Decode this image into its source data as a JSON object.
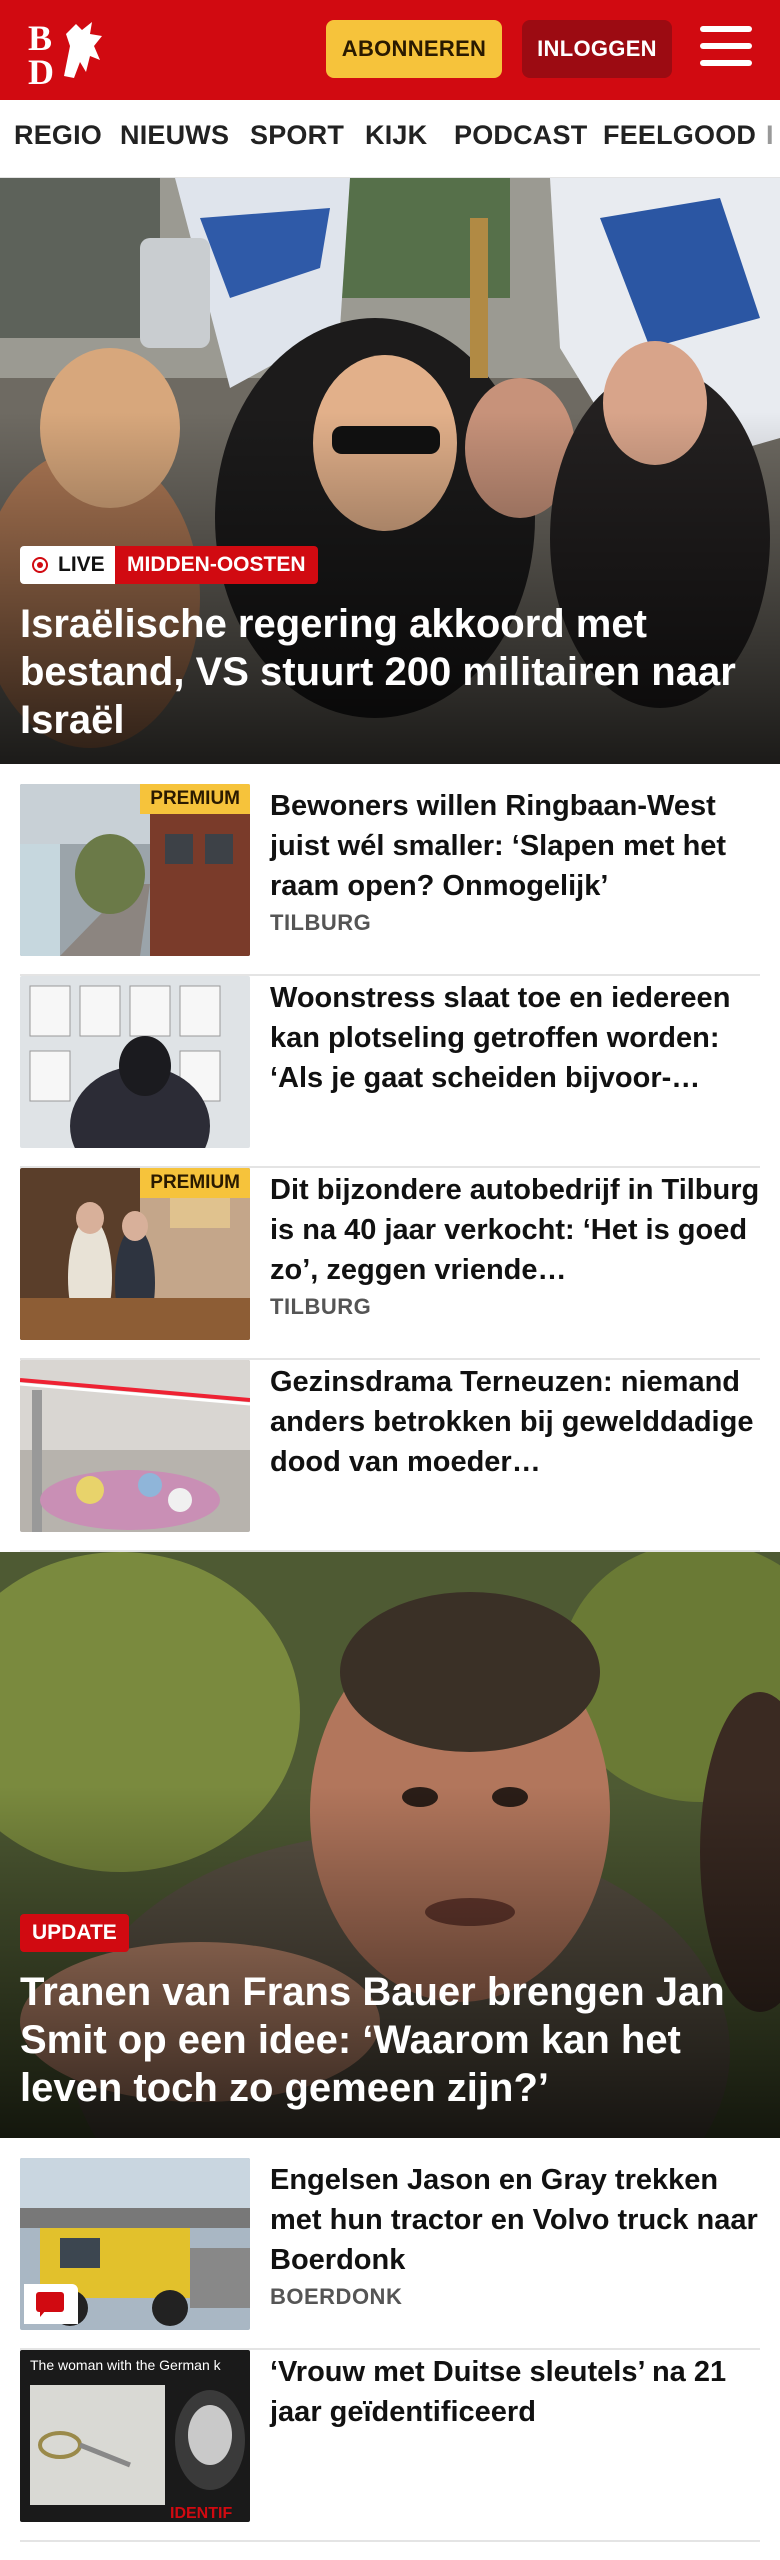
{
  "header": {
    "logo_text": "BD",
    "subscribe_label": "ABONNEREN",
    "login_label": "INLOGGEN",
    "brand_color": "#d10a11",
    "accent_color": "#f6c33b"
  },
  "nav": {
    "items": [
      "REGIO",
      "NIEUWS",
      "SPORT",
      "KIJK",
      "PODCAST",
      "FEELGOOD",
      "I"
    ]
  },
  "hero1": {
    "live_label": "LIVE",
    "category": "MIDDEN-OOSTEN",
    "title": "Israëlische regering akkoord met bestand, VS stuurt 200 militairen naar Israël"
  },
  "list1": [
    {
      "title": "Bewoners willen Ringbaan-West juist wél smaller: ‘Slapen met het raam open? Onmogelijk’",
      "location": "TILBURG",
      "premium": "PREMIUM"
    },
    {
      "title": "Woonstress slaat toe en iedereen kan plotseling getroffen worden: ‘Als je gaat scheiden bijvoor-…",
      "location": "",
      "premium": ""
    },
    {
      "title": "Dit bijzondere autobedrijf in Tilburg is na 40 jaar verkocht: ‘Het is goed zo’, zeggen vriende…",
      "location": "TILBURG",
      "premium": "PREMIUM"
    },
    {
      "title": "Gezinsdrama Terneuzen: niemand anders betrokken bij gewelddadige dood van moeder…",
      "location": "",
      "premium": ""
    }
  ],
  "hero2": {
    "badge": "UPDATE",
    "title": "Tranen van Frans Bauer brengen Jan Smit op een idee: ‘Waarom kan het leven toch zo gemeen zijn?’"
  },
  "list2": [
    {
      "title": "Engelsen Jason en Gray trekken met hun tractor en Volvo truck naar Boerdonk",
      "location": "BOERDONK",
      "icon": "comment-icon"
    },
    {
      "title": "‘Vrouw met Duitse sleutels’ na 21 jaar geïdentificeerd",
      "location": "",
      "thumb_caption": "The woman with the German k",
      "thumb_stamp": "IDENTIF"
    }
  ]
}
